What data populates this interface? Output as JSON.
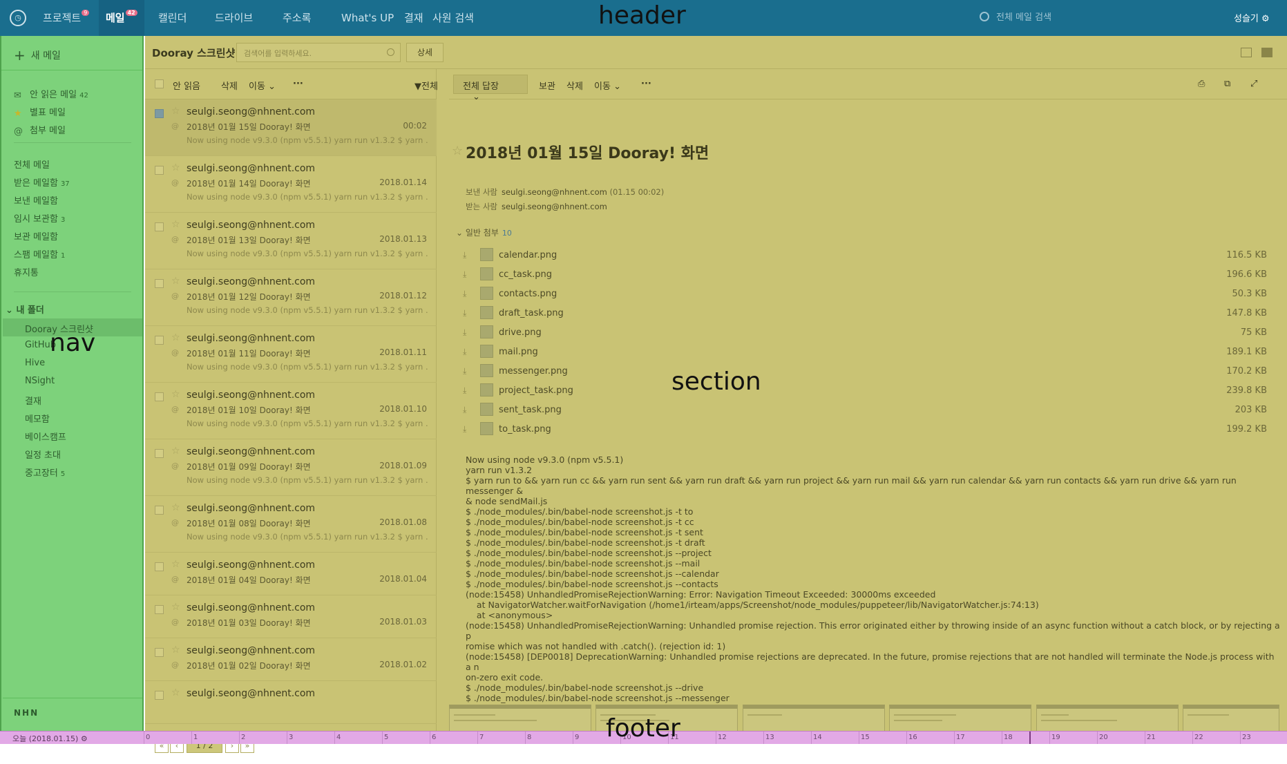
{
  "header": {
    "tabs": [
      {
        "label": "프로젝트",
        "badge": "9"
      },
      {
        "label": "메일",
        "badge": "42"
      },
      {
        "label": "캘린더",
        "badge": ""
      },
      {
        "label": "드라이브",
        "badge": ""
      },
      {
        "label": "주소록",
        "badge": ""
      },
      {
        "label": "What's UP",
        "badge": ""
      },
      {
        "label": "결재",
        "badge": ""
      },
      {
        "label": "사원 검색",
        "badge": ""
      }
    ],
    "region_label": "header",
    "search_placeholder": "전체 메일 검색",
    "user": "성슬기"
  },
  "nav": {
    "new_mail": "새 메일",
    "quick": [
      {
        "label": "안 읽은 메일",
        "count": "42"
      },
      {
        "label": "별표 메일",
        "count": ""
      },
      {
        "label": "첨부 메일",
        "count": ""
      }
    ],
    "boxes": [
      {
        "label": "전체 메일",
        "count": ""
      },
      {
        "label": "받은 메일함",
        "count": "37"
      },
      {
        "label": "보낸 메일함",
        "count": ""
      },
      {
        "label": "임시 보관함",
        "count": "3"
      },
      {
        "label": "보관 메일함",
        "count": ""
      },
      {
        "label": "스팸 메일함",
        "count": "1"
      },
      {
        "label": "휴지통",
        "count": ""
      }
    ],
    "my_folder": "내 폴더",
    "folders": [
      {
        "label": "Dooray 스크린샷",
        "count": ""
      },
      {
        "label": "GitHub",
        "count": ""
      },
      {
        "label": "Hive",
        "count": ""
      },
      {
        "label": "NSight",
        "count": ""
      },
      {
        "label": "결재",
        "count": ""
      },
      {
        "label": "메모함",
        "count": ""
      },
      {
        "label": "베이스캠프",
        "count": ""
      },
      {
        "label": "일정 초대",
        "count": ""
      },
      {
        "label": "중고장터",
        "count": "5"
      }
    ],
    "region_label": "nav",
    "logo": "NHN"
  },
  "toolbar": {
    "folder_title": "Dooray 스크린샷",
    "search_placeholder": "검색어를 입력하세요.",
    "detail": "상세"
  },
  "list_toolbar": {
    "unread": "안 읽음",
    "delete": "삭제",
    "move": "이동",
    "more": "···",
    "filter": "전체"
  },
  "mails": [
    {
      "from": "seulgi.seong@nhnent.com",
      "subject": "2018년 01월 15일 Dooray! 화면",
      "date": "00:02",
      "preview": "Now using node v9.3.0 (npm v5.5.1) yarn run v1.3.2 $ yarn ...",
      "selected": true
    },
    {
      "from": "seulgi.seong@nhnent.com",
      "subject": "2018년 01월 14일 Dooray! 화면",
      "date": "2018.01.14",
      "preview": "Now using node v9.3.0 (npm v5.5.1) yarn run v1.3.2 $ yarn ...",
      "selected": false
    },
    {
      "from": "seulgi.seong@nhnent.com",
      "subject": "2018년 01월 13일 Dooray! 화면",
      "date": "2018.01.13",
      "preview": "Now using node v9.3.0 (npm v5.5.1) yarn run v1.3.2 $ yarn ...",
      "selected": false
    },
    {
      "from": "seulgi.seong@nhnent.com",
      "subject": "2018년 01월 12일 Dooray! 화면",
      "date": "2018.01.12",
      "preview": "Now using node v9.3.0 (npm v5.5.1) yarn run v1.3.2 $ yarn ...",
      "selected": false
    },
    {
      "from": "seulgi.seong@nhnent.com",
      "subject": "2018년 01월 11일 Dooray! 화면",
      "date": "2018.01.11",
      "preview": "Now using node v9.3.0 (npm v5.5.1) yarn run v1.3.2 $ yarn ...",
      "selected": false
    },
    {
      "from": "seulgi.seong@nhnent.com",
      "subject": "2018년 01월 10일 Dooray! 화면",
      "date": "2018.01.10",
      "preview": "Now using node v9.3.0 (npm v5.5.1) yarn run v1.3.2 $ yarn ...",
      "selected": false
    },
    {
      "from": "seulgi.seong@nhnent.com",
      "subject": "2018년 01월 09일 Dooray! 화면",
      "date": "2018.01.09",
      "preview": "Now using node v9.3.0 (npm v5.5.1) yarn run v1.3.2 $ yarn ...",
      "selected": false
    },
    {
      "from": "seulgi.seong@nhnent.com",
      "subject": "2018년 01월 08일 Dooray! 화면",
      "date": "2018.01.08",
      "preview": "Now using node v9.3.0 (npm v5.5.1) yarn run v1.3.2 $ yarn ...",
      "selected": false
    },
    {
      "from": "seulgi.seong@nhnent.com",
      "subject": "2018년 01월 04일 Dooray! 화면",
      "date": "2018.01.04",
      "preview": "",
      "selected": false
    },
    {
      "from": "seulgi.seong@nhnent.com",
      "subject": "2018년 01월 03일 Dooray! 화면",
      "date": "2018.01.03",
      "preview": "",
      "selected": false
    },
    {
      "from": "seulgi.seong@nhnent.com",
      "subject": "2018년 01월 02일 Dooray! 화면",
      "date": "2018.01.02",
      "preview": "",
      "selected": false
    },
    {
      "from": "seulgi.seong@nhnent.com",
      "subject": "",
      "date": "",
      "preview": "",
      "selected": false
    }
  ],
  "pager": {
    "page": "1 / 2"
  },
  "reader": {
    "reply_all": "전체 답장",
    "archive": "보관",
    "delete": "삭제",
    "move": "이동",
    "more": "···",
    "subject": "2018년 01월 15일 Dooray! 화면",
    "from_label": "보낸 사람",
    "from": "seulgi.seong@nhnent.com",
    "from_time": "(01.15 00:02)",
    "to_label": "받는 사람",
    "to": "seulgi.seong@nhnent.com",
    "attach_label": "일반 첨부",
    "attach_count": "10",
    "attachments": [
      {
        "name": "calendar.png",
        "size": "116.5 KB"
      },
      {
        "name": "cc_task.png",
        "size": "196.6 KB"
      },
      {
        "name": "contacts.png",
        "size": "50.3 KB"
      },
      {
        "name": "draft_task.png",
        "size": "147.8 KB"
      },
      {
        "name": "drive.png",
        "size": "75 KB"
      },
      {
        "name": "mail.png",
        "size": "189.1 KB"
      },
      {
        "name": "messenger.png",
        "size": "170.2 KB"
      },
      {
        "name": "project_task.png",
        "size": "239.8 KB"
      },
      {
        "name": "sent_task.png",
        "size": "203 KB"
      },
      {
        "name": "to_task.png",
        "size": "199.2 KB"
      }
    ],
    "body": "Now using node v9.3.0 (npm v5.5.1)\nyarn run v1.3.2\n$ yarn run to && yarn run cc && yarn run sent && yarn run draft && yarn run project && yarn run mail && yarn run calendar && yarn run contacts && yarn run drive && yarn run messenger &\n& node sendMail.js\n$ ./node_modules/.bin/babel-node screenshot.js -t to\n$ ./node_modules/.bin/babel-node screenshot.js -t cc\n$ ./node_modules/.bin/babel-node screenshot.js -t sent\n$ ./node_modules/.bin/babel-node screenshot.js -t draft\n$ ./node_modules/.bin/babel-node screenshot.js --project\n$ ./node_modules/.bin/babel-node screenshot.js --mail\n$ ./node_modules/.bin/babel-node screenshot.js --calendar\n$ ./node_modules/.bin/babel-node screenshot.js --contacts\n(node:15458) UnhandledPromiseRejectionWarning: Error: Navigation Timeout Exceeded: 30000ms exceeded\n    at NavigatorWatcher.waitForNavigation (/home1/irteam/apps/Screenshot/node_modules/puppeteer/lib/NavigatorWatcher.js:74:13)\n    at <anonymous>\n(node:15458) UnhandledPromiseRejectionWarning: Unhandled promise rejection. This error originated either by throwing inside of an async function without a catch block, or by rejecting a p\nromise which was not handled with .catch(). (rejection id: 1)\n(node:15458) [DEP0018] DeprecationWarning: Unhandled promise rejections are deprecated. In the future, promise rejections that are not handled will terminate the Node.js process with a n\non-zero exit code.\n$ ./node_modules/.bin/babel-node screenshot.js --drive\n$ ./node_modules/.bin/babel-node screenshot.js --messenger",
    "region_label": "section"
  },
  "footer": {
    "today": "오늘 (2018.01.15)",
    "hours": [
      "0",
      "1",
      "2",
      "3",
      "4",
      "5",
      "6",
      "7",
      "8",
      "9",
      "10",
      "11",
      "12",
      "13",
      "14",
      "15",
      "16",
      "17",
      "18",
      "19",
      "20",
      "21",
      "22",
      "23"
    ],
    "region_label": "footer"
  },
  "colors": {
    "header": "#1a6e8e",
    "nav": "#7dd27b",
    "main": "#c9c374",
    "footer": "#e2a9e6"
  }
}
